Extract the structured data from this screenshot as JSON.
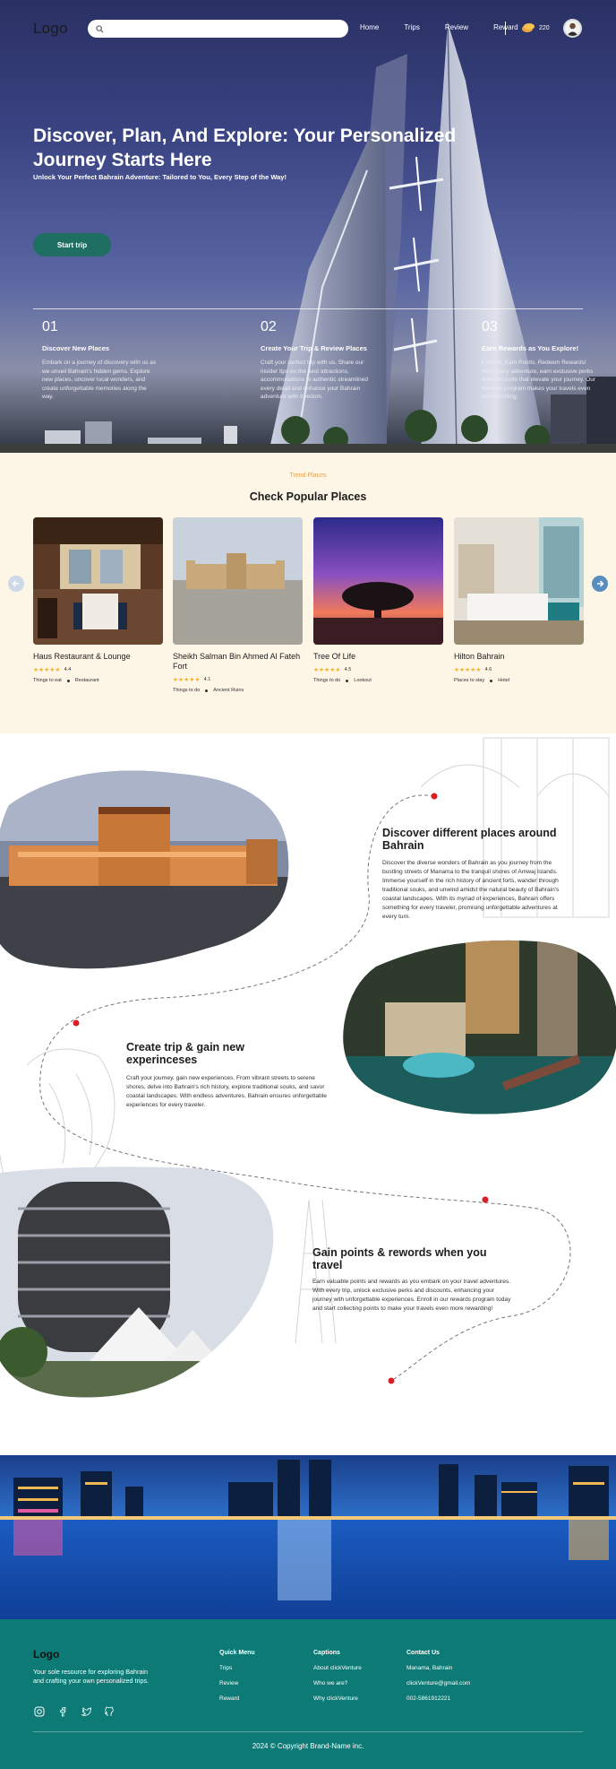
{
  "header": {
    "logo": "Logo",
    "search": {
      "placeholder": "",
      "value": ""
    },
    "nav": [
      "Home",
      "Trips",
      "Review",
      "Reward"
    ],
    "points": "220"
  },
  "hero": {
    "title": "Discover, Plan, And Explore: Your Personalized Journey Starts Here",
    "subtitle": "Unlock Your Perfect Bahrain Adventure: Tailored to You, Every Step of the Way!",
    "cta": "Start trip",
    "steps": [
      {
        "num": "01",
        "title": "Discover New Places",
        "text": "Embark on a journey of discovery with us as we unveil Bahrain's hidden gems. Explore new places, uncover local wonders, and create unforgettable memories along the way."
      },
      {
        "num": "02",
        "title": "Create Your Trip & Review Places",
        "text": "Craft your perfect trip with us. Share our insider tips on the best attractions, accommodations to authentic streamlined every detail and enhance your Bahrain adventure with freedom."
      },
      {
        "num": "03",
        "title": "Earn Rewards as You Explore!",
        "text": "Explore, Earn Points, Redeem Rewards! With every adventure, earn exclusive perks and discounts that elevate your journey. Our rewards program makes your travels even more exciting."
      }
    ]
  },
  "popular": {
    "eyebrow": "Trend Places",
    "title": "Check Popular Places",
    "cards": [
      {
        "name": "Haus Restaurant & Lounge",
        "rating": "4.4",
        "stars": "★★★★★",
        "category": "Things to eat",
        "tag": "Restaurant"
      },
      {
        "name": "Sheikh Salman Bin Ahmed Al Fateh Fort",
        "rating": "4.1",
        "stars": "★★★★★",
        "category": "Things to do",
        "tag": "Ancient Ruins"
      },
      {
        "name": "Tree Of Life",
        "rating": "4.5",
        "stars": "★★★★★",
        "category": "Things to do",
        "tag": "Lookout"
      },
      {
        "name": "Hilton Bahrain",
        "rating": "4.6",
        "stars": "★★★★★",
        "category": "Places to stay",
        "tag": "Hotel"
      }
    ]
  },
  "features": [
    {
      "title": "Discover different places around Bahrain",
      "text": "Discover the diverse wonders of Bahrain as you journey from the bustling streets of Manama to the tranquil shores of Amwaj Islands. Immerse yourself in the rich history of ancient forts, wander through traditional souks, and unwind amidst the natural beauty of Bahrain's coastal landscapes. With its myriad of experiences, Bahrain offers something for every traveler, promising unforgettable adventures at every turn."
    },
    {
      "title": "Create trip & gain new experinceses",
      "text": "Craft your journey, gain new experiences. From vibrant streets to serene shores, delve into Bahrain's rich history, explore traditional souks, and savor coastal landscapes. With endless adventures, Bahrain ensures unforgettable experiences for every traveler."
    },
    {
      "title": "Gain points & rewords when you travel",
      "text": "Earn valuable points and rewards as you embark on your travel adventures. With every trip, unlock exclusive perks and discounts, enhancing your journey with unforgettable experiences. Enroll in our rewards program today and start collecting points to make your travels even more rewarding!"
    }
  ],
  "footer": {
    "logo": "Logo",
    "tagline": "Your sole resource for exploring Bahrain and crafting your own personalized trips.",
    "columns": [
      {
        "title": "Quick Menu",
        "links": [
          "Trips",
          "Review",
          "Reward"
        ]
      },
      {
        "title": "Captions",
        "links": [
          "About clickVenture",
          "Who we are?",
          "Why clickVenture"
        ]
      },
      {
        "title": "Contact Us",
        "links": [
          "Manama, Bahrain",
          "clickVenture@gmail.com",
          "002-5861912221"
        ]
      }
    ],
    "copyright": "2024 © Copyright Brand-Name inc."
  },
  "colors": {
    "brand_teal": "#0d7a76",
    "cta_green": "#1f6e62",
    "accent_orange": "#e9a24b",
    "path_red": "#d81f26",
    "cream": "#fdf5e5"
  }
}
